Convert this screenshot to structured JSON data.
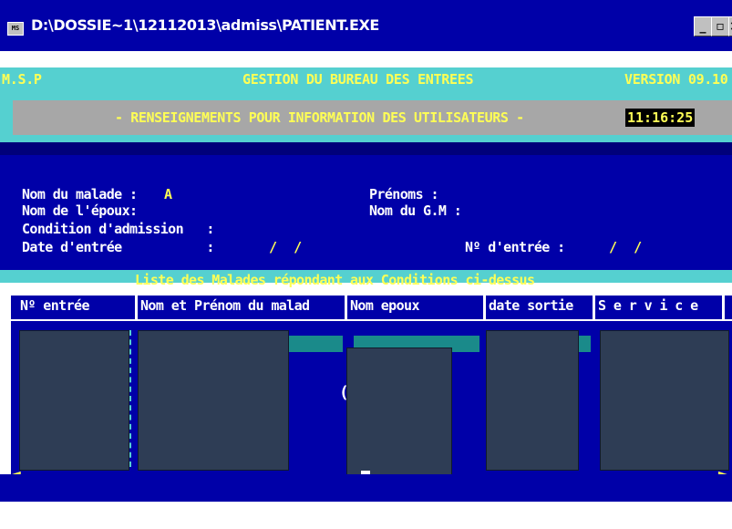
{
  "window": {
    "title": "D:\\DOSSIE~1\\12112013\\admiss\\PATIENT.EXE",
    "icon_name": "msdos-icon",
    "min_label": "_",
    "max_label": "▫",
    "close_label": "×"
  },
  "header": {
    "left": "M.S.P",
    "center": "GESTION DU BUREAU DES ENTREES",
    "right": "VERSION  09.10",
    "subtitle": "- RENSEIGNEMENTS POUR INFORMATION DES UTILISATEURS -",
    "clock": "11:16:25"
  },
  "form": {
    "nom_malade_label": "Nom du malade :",
    "nom_malade_value": "A",
    "prenoms_label": "Prénoms :",
    "nom_epoux_label": "Nom de l'époux:",
    "nom_gm_label": "Nom du G.M :",
    "condition_label": "Condition d'admission   :",
    "date_entree_label": "Date d'entrée           :",
    "date_entree_value": "/  /",
    "no_entree_label": "Nº d'entrée :",
    "no_entree_value": "/  /"
  },
  "list": {
    "title": "Liste des Malades répondant aux Conditions ci-dessus",
    "columns": [
      "Nº entrée",
      "Nom et Prénom du malad",
      "Nom epoux",
      "date sortie",
      "S e r v i c e"
    ]
  },
  "colors": {
    "background": "#0000a8",
    "accent_cyan": "#55d0d0",
    "text_yellow": "#ffff55",
    "redaction": "#2e3d55"
  }
}
